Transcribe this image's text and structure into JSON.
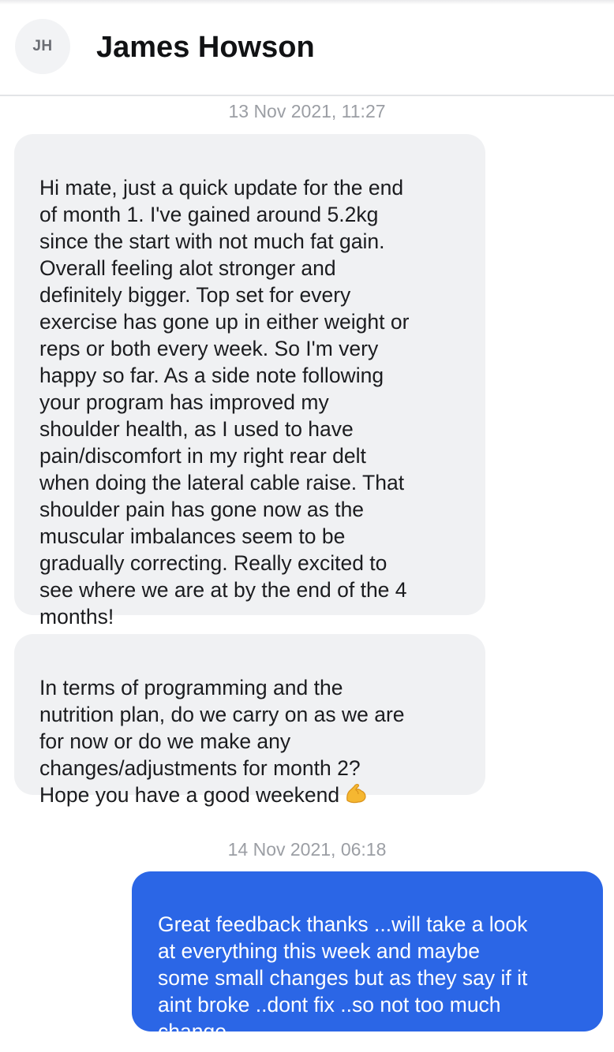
{
  "contact": {
    "initials": "JH",
    "name": "James Howson"
  },
  "messages": [
    {
      "timestamp": "13 Nov 2021, 11:27",
      "text": "Hi mate, just a quick update for the end\nof month 1. I've gained around 5.2kg\nsince the start with not much fat gain.\nOverall feeling alot stronger and\ndefinitely bigger. Top set for every\nexercise has gone up in either weight or\nreps or both every week. So I'm very\nhappy so far. As a side note following\nyour program has improved my\nshoulder health, as I used to have\npain/discomfort in my right rear delt\nwhen doing the lateral cable raise. That\nshoulder pain has gone now as the\nmuscular imbalances seem to be\ngradually correcting. Really excited to\nsee where we are at by the end of the 4\nmonths!",
      "direction": "incoming"
    },
    {
      "text": "In terms of programming and the\nnutrition plan, do we carry on as we are\nfor now or do we make any\nchanges/adjustments for month 2?\nHope you have a good weekend",
      "emoji": "flexed-biceps-icon",
      "direction": "incoming"
    },
    {
      "timestamp": "14 Nov 2021, 06:18",
      "text": "Great feedback thanks ...will take a look\nat everything this week and maybe\nsome small changes but as they say if it\naint broke ..dont fix ..so not too much\nchange",
      "direction": "outgoing"
    }
  ],
  "colors": {
    "outgoing_bubble": "#2b66e6",
    "incoming_bubble": "#f0f1f3",
    "timestamp": "#9b9ea4"
  }
}
